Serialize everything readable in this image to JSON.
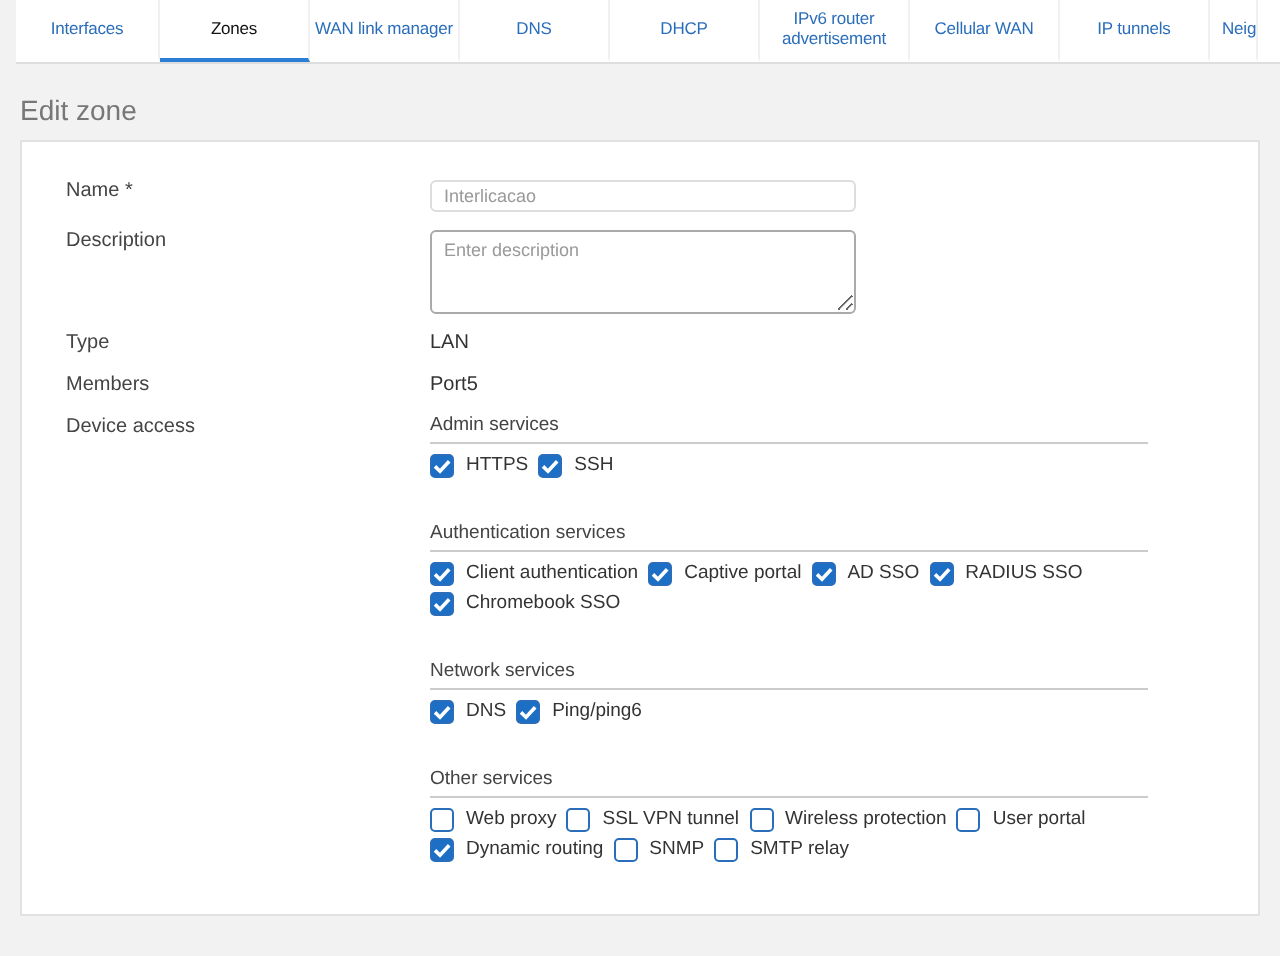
{
  "tabs": [
    {
      "label": "Interfaces",
      "selected": false
    },
    {
      "label": "Zones",
      "selected": true
    },
    {
      "label": "WAN link manager",
      "selected": false
    },
    {
      "label": "DNS",
      "selected": false
    },
    {
      "label": "DHCP",
      "selected": false
    },
    {
      "label": "IPv6 router advertisement",
      "selected": false
    },
    {
      "label": "Cellular WAN",
      "selected": false
    },
    {
      "label": "IP tunnels",
      "selected": false
    },
    {
      "label": "Neig",
      "selected": false
    }
  ],
  "heading": "Edit zone",
  "form": {
    "name": {
      "label": "Name *",
      "placeholder": "Interlicacao"
    },
    "description": {
      "label": "Description",
      "placeholder": "Enter description"
    },
    "type": {
      "label": "Type",
      "value": "LAN"
    },
    "members": {
      "label": "Members",
      "value": "Port5"
    },
    "device_access": {
      "label": "Device access",
      "groups": [
        {
          "title": "Admin services",
          "options": [
            {
              "label": "HTTPS",
              "checked": true
            },
            {
              "label": "SSH",
              "checked": true
            }
          ]
        },
        {
          "title": "Authentication services",
          "options": [
            {
              "label": "Client authentication",
              "checked": true
            },
            {
              "label": "Captive portal",
              "checked": true
            },
            {
              "label": "AD SSO",
              "checked": true
            },
            {
              "label": "RADIUS SSO",
              "checked": true
            },
            {
              "label": "Chromebook SSO",
              "checked": true
            }
          ]
        },
        {
          "title": "Network services",
          "options": [
            {
              "label": "DNS",
              "checked": true
            },
            {
              "label": "Ping/ping6",
              "checked": true
            }
          ]
        },
        {
          "title": "Other services",
          "options": [
            {
              "label": "Web proxy",
              "checked": false
            },
            {
              "label": "SSL VPN tunnel",
              "checked": false
            },
            {
              "label": "Wireless protection",
              "checked": false
            },
            {
              "label": "User portal",
              "checked": false
            },
            {
              "label": "Dynamic routing",
              "checked": true
            },
            {
              "label": "SNMP",
              "checked": false
            },
            {
              "label": "SMTP relay",
              "checked": false
            }
          ]
        }
      ]
    }
  }
}
